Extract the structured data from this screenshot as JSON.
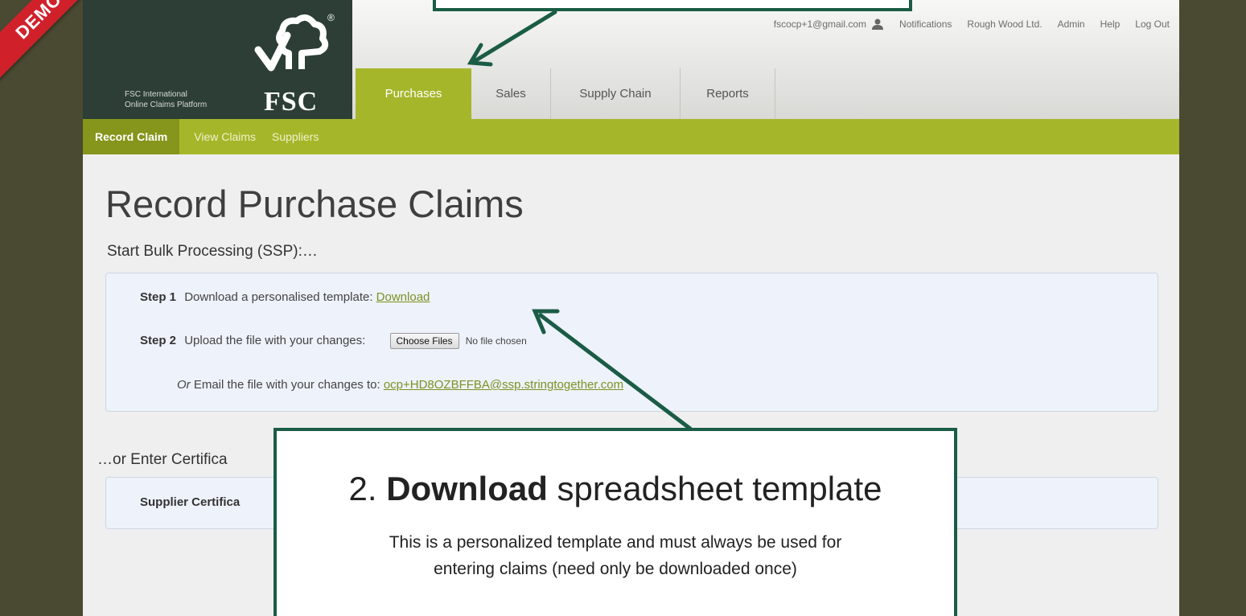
{
  "banner": {
    "text": "DEMO USE ONLY"
  },
  "logo": {
    "line1": "FSC International",
    "line2": "Online Claims Platform",
    "wordmark": "FSC",
    "registered": "®"
  },
  "topnav": {
    "email": "fscocp+1@gmail.com",
    "notifications": "Notifications",
    "company": "Rough Wood Ltd.",
    "admin": "Admin",
    "help": "Help",
    "logout": "Log Out"
  },
  "tabs": [
    {
      "label": "Purchases"
    },
    {
      "label": "Sales"
    },
    {
      "label": "Supply Chain"
    },
    {
      "label": "Reports"
    }
  ],
  "subnav": [
    {
      "label": "Record Claim"
    },
    {
      "label": "View Claims"
    },
    {
      "label": "Suppliers"
    }
  ],
  "page": {
    "title": "Record Purchase Claims",
    "bulk_heading": "Start Bulk Processing (SSP):…",
    "step1_label": "Step 1",
    "step1_text": "Download a personalised template:",
    "step1_link": "Download",
    "step2_label": "Step 2",
    "step2_text": "Upload the file with your changes:",
    "choose_files": "Choose Files",
    "no_file": "No file chosen",
    "or_label": "Or",
    "email_text": "Email the file with your changes to:",
    "email_link": "ocp+HD8OZBFFBA@ssp.stringtogether.com",
    "enter_heading": "…or Enter Certifica",
    "supplier_label": "Supplier Certifica"
  },
  "callout": {
    "number": "2.",
    "bold": "Download",
    "rest": "spreadsheet template",
    "desc_line1": "This is a personalized template and must always be used for",
    "desc_line2": "entering claims (need only be downloaded once)"
  },
  "colors": {
    "accent": "#a6b62a",
    "callout_border": "#1a5c45",
    "banner": "#d0212b",
    "frame": "#4a4a32"
  }
}
